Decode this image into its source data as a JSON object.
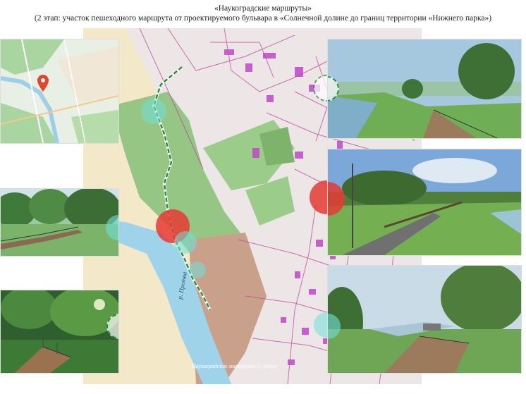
{
  "header": {
    "title": "«Наукоградские маршруты»",
    "subtitle": "(2 этап: участок пешеходного маршрута от проектируемого бульвара в «Солнечной долине до границ территории «Нижнего парка»)"
  },
  "map": {
    "river_label": "р. Протва",
    "caption": "Наукоградские маршруты (2 этап)",
    "colors": {
      "forest": "#8cc27b",
      "river": "#9ed3ea",
      "parcel_line": "#c2409a",
      "building": "#c048c8",
      "route": "#2f8a3d",
      "marker_red": "#e53935",
      "marker_cyan": "#6fe0d8"
    }
  },
  "locator_map": {
    "pin_icon": "map-pin-icon"
  }
}
